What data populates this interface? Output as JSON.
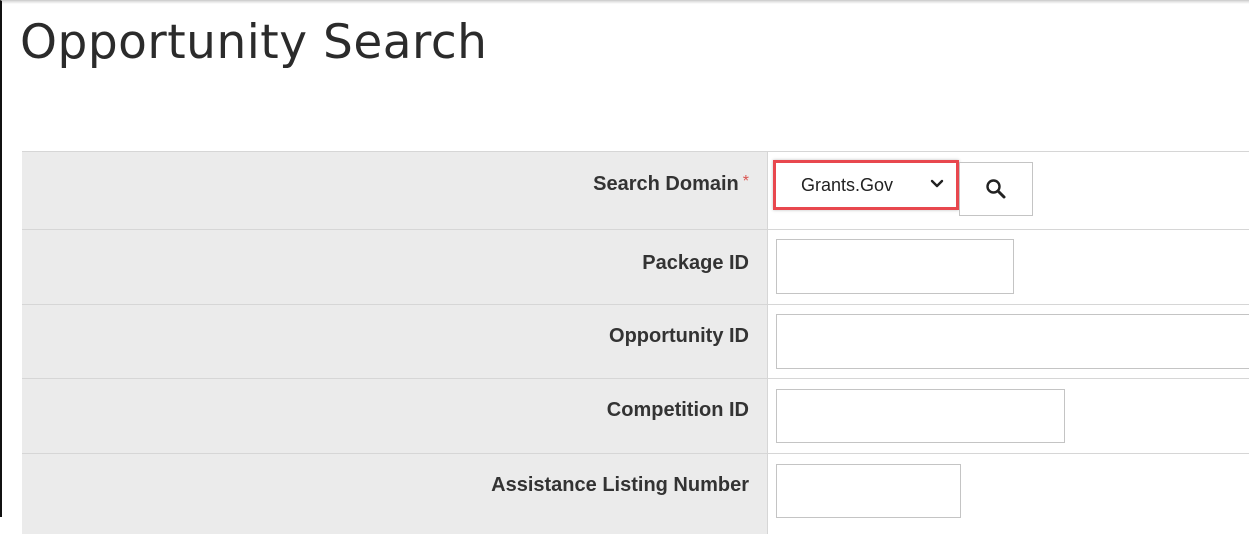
{
  "page": {
    "title": "Opportunity Search"
  },
  "form": {
    "search_domain": {
      "label": "Search Domain",
      "required_marker": "*",
      "selected_value": "Grants.Gov"
    },
    "package_id": {
      "label": "Package ID",
      "value": ""
    },
    "opportunity_id": {
      "label": "Opportunity ID",
      "value": ""
    },
    "competition_id": {
      "label": "Competition ID",
      "value": ""
    },
    "assistance_listing_number": {
      "label": "Assistance Listing Number",
      "value": ""
    }
  },
  "icons": {
    "search": "search-icon",
    "dropdown": "chevron-down-icon"
  },
  "colors": {
    "highlight_border": "#e8474e",
    "required_star": "#d9534f",
    "label_background": "#ebebeb",
    "title_text": "#2b2b2b"
  }
}
